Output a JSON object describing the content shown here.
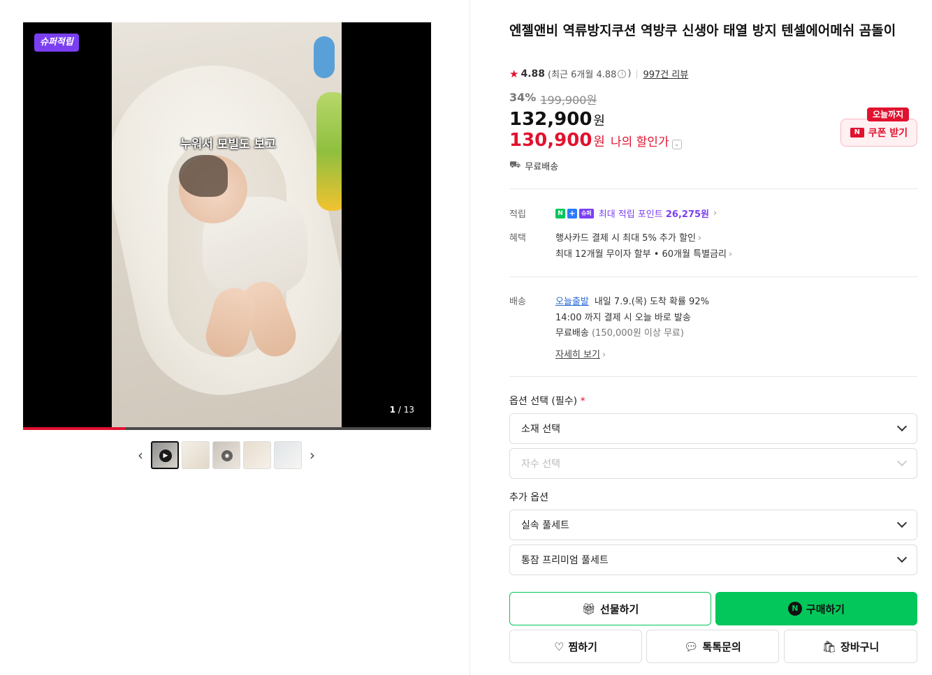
{
  "media": {
    "badge": "슈퍼적립",
    "caption": "누워서 모빌도 보고",
    "counter_current": "1",
    "counter_total": "13",
    "progress_fraction": 0.25
  },
  "thumbnails": [
    {
      "icon": "play-icon"
    },
    {
      "icon": null
    },
    {
      "icon": "360-icon"
    },
    {
      "icon": null
    },
    {
      "icon": null
    }
  ],
  "product": {
    "title": "엔젤앤비 역류방지쿠션 역방쿠 신생아 태열 방지 텐셀에어메쉬 곰돌이",
    "rating": {
      "score": "4.88",
      "recent_prefix": "(최근 6개월 4.88",
      "recent_suffix": ")",
      "reviews": "997건 리뷰"
    },
    "price": {
      "discount": "34%",
      "original": "199,900원",
      "sale": "132,900",
      "sale_unit": "원",
      "my_price": "130,900",
      "my_unit": "원",
      "my_label": "나의 할인가"
    },
    "coupon": {
      "tag": "오늘까지",
      "logo": "N",
      "label": "쿠폰 받기"
    },
    "free_shipping": "무료배송"
  },
  "benefits": {
    "points_label": "적립",
    "points_n": "N",
    "points_plus": "+",
    "points_super": "슈퍼",
    "points_text": "최대 적립 포인트",
    "points_value": "26,275원",
    "perks_label": "혜택",
    "perk1": "행사카드 결제 시 최대 5% 추가 할인",
    "perk2": "최대 12개월 무이자 할부 • 60개월 특별금리"
  },
  "delivery": {
    "label": "배송",
    "today": "오늘출발",
    "arrival": "내일 7.9.(목) 도착 확률 92%",
    "cutoff": "14:00 까지 결제 시 오늘 바로 발송",
    "free": "무료배송",
    "free_cond": "(150,000원 이상 무료)",
    "detail_link": "자세히 보기"
  },
  "options": {
    "required_label": "옵션 선택 (필수)",
    "required_mark": "*",
    "material": "소재 선택",
    "embroidery": "자수 선택",
    "extra_label": "추가 옵션",
    "extra1": "실속 풀세트",
    "extra2": "통잠 프리미엄 풀세트"
  },
  "actions": {
    "gift": "선물하기",
    "buy_badge": "N",
    "buy": "구매하기",
    "wish": "찜하기",
    "talk": "톡톡문의",
    "cart": "장바구니"
  },
  "colors": {
    "accent_red": "#e1122f",
    "naver_green": "#03c75a",
    "super_purple": "#7b3ff2"
  }
}
